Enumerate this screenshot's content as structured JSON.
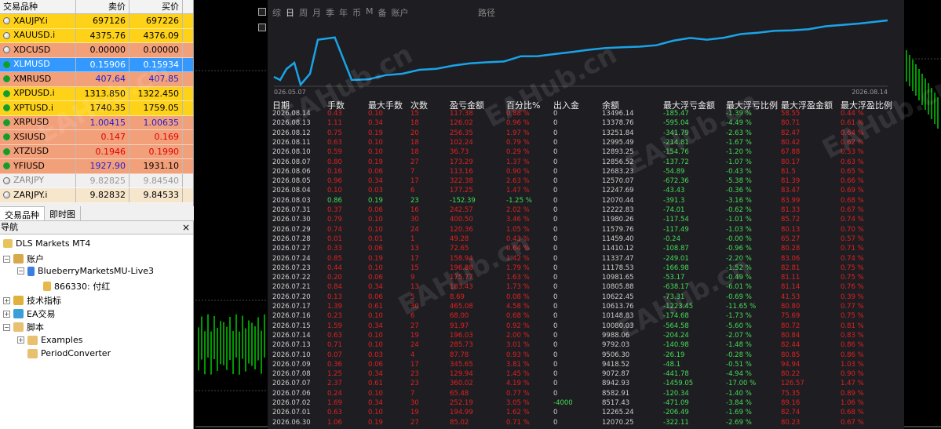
{
  "market_watch": {
    "headers": {
      "symbol": "交易品种",
      "bid": "卖价",
      "ask": "买价"
    },
    "rows": [
      {
        "symbol": "XAUJPY.i",
        "bid": "697126",
        "ask": "697226",
        "style": "yellow",
        "dot": "grey",
        "bid_class": "",
        "ask_class": ""
      },
      {
        "symbol": "XAUUSD.i",
        "bid": "4375.76",
        "ask": "4376.09",
        "style": "yellow",
        "dot": "grey",
        "bid_class": "",
        "ask_class": ""
      },
      {
        "symbol": "XDCUSD",
        "bid": "0.00000",
        "ask": "0.00000",
        "style": "salmon",
        "dot": "grey",
        "bid_class": "",
        "ask_class": ""
      },
      {
        "symbol": "XLMUSD",
        "bid": "0.15906",
        "ask": "0.15934",
        "style": "blue",
        "dot": "green",
        "bid_class": "",
        "ask_class": ""
      },
      {
        "symbol": "XMRUSD",
        "bid": "407.64",
        "ask": "407.85",
        "style": "salmon",
        "dot": "green",
        "bid_class": "v-blue",
        "ask_class": "v-blue"
      },
      {
        "symbol": "XPDUSD.i",
        "bid": "1313.850",
        "ask": "1322.450",
        "style": "yellow",
        "dot": "green",
        "bid_class": "",
        "ask_class": ""
      },
      {
        "symbol": "XPTUSD.i",
        "bid": "1740.35",
        "ask": "1759.05",
        "style": "yellow",
        "dot": "green",
        "bid_class": "",
        "ask_class": ""
      },
      {
        "symbol": "XRPUSD",
        "bid": "1.00415",
        "ask": "1.00635",
        "style": "salmon",
        "dot": "green",
        "bid_class": "v-blue",
        "ask_class": "v-blue"
      },
      {
        "symbol": "XSIUSD",
        "bid": "0.147",
        "ask": "0.169",
        "style": "salmon",
        "dot": "green",
        "bid_class": "v-red",
        "ask_class": "v-red"
      },
      {
        "symbol": "XTZUSD",
        "bid": "0.1946",
        "ask": "0.1990",
        "style": "salmon",
        "dot": "green",
        "bid_class": "v-red",
        "ask_class": "v-red"
      },
      {
        "symbol": "YFIUSD",
        "bid": "1927.90",
        "ask": "1931.10",
        "style": "salmon",
        "dot": "green",
        "bid_class": "v-blue",
        "ask_class": ""
      },
      {
        "symbol": "ZARJPY",
        "bid": "9.82825",
        "ask": "9.84540",
        "style": "grey",
        "dot": "grey",
        "bid_class": "v-grey",
        "ask_class": "v-grey"
      },
      {
        "symbol": "ZARJPY.i",
        "bid": "9.82832",
        "ask": "9.84533",
        "style": "pale",
        "dot": "grey",
        "bid_class": "",
        "ask_class": ""
      }
    ],
    "tabs": [
      "交易品种",
      "即时图"
    ]
  },
  "navigator": {
    "title": "导航",
    "close": "×",
    "items": {
      "root": "DLS Markets MT4",
      "accounts": "账户",
      "server": "BlueberryMarketsMU-Live3",
      "account": "866330: 付红",
      "indicators": "技术指标",
      "ea": "EA交易",
      "scripts": "脚本",
      "examples": "Examples",
      "period_converter": "PeriodConverter"
    }
  },
  "report": {
    "period_tabs": [
      "综",
      "日",
      "周",
      "月",
      "季",
      "年",
      "币",
      "M",
      "备",
      "账户"
    ],
    "active_period": "日",
    "period_label": "路径",
    "equity_start_label": "026.05.07",
    "equity_end_label": "2026.08.14",
    "headers": [
      "日期",
      "手数",
      "最大手数",
      "次数",
      "盈亏金额",
      "百分比%",
      "出入金",
      "余额",
      "最大浮亏金额",
      "最大浮亏比例",
      "最大浮盈金额",
      "最大浮盈比例"
    ],
    "rows": [
      [
        "2026.08.14",
        "0.43",
        "0.10",
        "15",
        "117.38",
        "0.88 %",
        "0",
        "13496.14",
        "-185.47",
        "-1.39 %",
        "58.55",
        "0.44 %"
      ],
      [
        "2026.08.13",
        "1.11",
        "0.34",
        "18",
        "126.02",
        "0.96 %",
        "0",
        "13378.76",
        "-595.04",
        "-4.49 %",
        "80.71",
        "0.61 %"
      ],
      [
        "2026.08.12",
        "0.75",
        "0.19",
        "20",
        "256.35",
        "1.97 %",
        "0",
        "13251.84",
        "-341.79",
        "-2.63 %",
        "82.47",
        "0.64 %"
      ],
      [
        "2026.08.11",
        "0.63",
        "0.10",
        "18",
        "102.24",
        "0.79 %",
        "0",
        "12995.49",
        "-214.81",
        "-1.67 %",
        "80.42",
        "0.62 %"
      ],
      [
        "2026.08.10",
        "0.59",
        "0.10",
        "18",
        "36.73",
        "0.29 %",
        "0",
        "12893.25",
        "-154.76",
        "-1.20 %",
        "67.88",
        "0.53 %"
      ],
      [
        "2026.08.07",
        "0.80",
        "0.19",
        "27",
        "173.29",
        "1.37 %",
        "0",
        "12856.52",
        "-137.72",
        "-1.07 %",
        "80.17",
        "0.63 %"
      ],
      [
        "2026.08.06",
        "0.16",
        "0.06",
        "7",
        "113.16",
        "0.90 %",
        "0",
        "12683.23",
        "-54.89",
        "-0.43 %",
        "81.5",
        "0.65 %"
      ],
      [
        "2026.08.05",
        "0.96",
        "0.34",
        "17",
        "322.38",
        "2.63 %",
        "0",
        "12570.07",
        "-672.36",
        "-5.38 %",
        "81.39",
        "0.66 %"
      ],
      [
        "2026.08.04",
        "0.10",
        "0.03",
        "6",
        "177.25",
        "1.47 %",
        "0",
        "12247.69",
        "-43.43",
        "-0.36 %",
        "83.47",
        "0.69 %"
      ],
      [
        "2026.08.03",
        "0.86",
        "0.19",
        "23",
        "-152.39",
        "-1.25 %",
        "0",
        "12070.44",
        "-391.3",
        "-3.16 %",
        "83.99",
        "0.68 %"
      ],
      [
        "2026.07.31",
        "0.37",
        "0.06",
        "16",
        "242.57",
        "2.02 %",
        "0",
        "12222.83",
        "-74.01",
        "-0.62 %",
        "81.33",
        "0.67 %"
      ],
      [
        "2026.07.30",
        "0.79",
        "0.10",
        "30",
        "400.50",
        "3.46 %",
        "0",
        "11980.26",
        "-117.54",
        "-1.01 %",
        "85.72",
        "0.74 %"
      ],
      [
        "2026.07.29",
        "0.74",
        "0.10",
        "24",
        "120.36",
        "1.05 %",
        "0",
        "11579.76",
        "-117.49",
        "-1.03 %",
        "80.13",
        "0.70 %"
      ],
      [
        "2026.07.28",
        "0.01",
        "0.01",
        "1",
        "49.28",
        "0.43 %",
        "0",
        "11459.40",
        "-0.24",
        "-0.00 %",
        "65.27",
        "0.57 %"
      ],
      [
        "2026.07.27",
        "0.33",
        "0.06",
        "13",
        "72.65",
        "0.64 %",
        "0",
        "11410.12",
        "-108.87",
        "-0.96 %",
        "80.28",
        "0.71 %"
      ],
      [
        "2026.07.24",
        "0.85",
        "0.19",
        "17",
        "158.94",
        "1.42 %",
        "0",
        "11337.47",
        "-249.01",
        "-2.20 %",
        "83.06",
        "0.74 %"
      ],
      [
        "2026.07.23",
        "0.44",
        "0.10",
        "15",
        "196.88",
        "1.79 %",
        "0",
        "11178.53",
        "-166.98",
        "-1.52 %",
        "82.81",
        "0.75 %"
      ],
      [
        "2026.07.22",
        "0.20",
        "0.06",
        "9",
        "175.77",
        "1.63 %",
        "0",
        "10981.65",
        "-53.17",
        "-0.49 %",
        "81.11",
        "0.75 %"
      ],
      [
        "2026.07.21",
        "0.84",
        "0.34",
        "13",
        "183.43",
        "1.73 %",
        "0",
        "10805.88",
        "-638.17",
        "-6.01 %",
        "81.14",
        "0.76 %"
      ],
      [
        "2026.07.20",
        "0.13",
        "0.06",
        "5",
        "8.69",
        "0.08 %",
        "0",
        "10622.45",
        "-73.31",
        "-0.69 %",
        "41.53",
        "0.39 %"
      ],
      [
        "2026.07.17",
        "1.39",
        "0.61",
        "30",
        "465.08",
        "4.58 %",
        "0",
        "10613.76",
        "-1223.45",
        "-11.65 %",
        "80.80",
        "0.77 %"
      ],
      [
        "2026.07.16",
        "0.23",
        "0.10",
        "6",
        "68.00",
        "0.68 %",
        "0",
        "10148.83",
        "-174.68",
        "-1.73 %",
        "75.69",
        "0.75 %"
      ],
      [
        "2026.07.15",
        "1.59",
        "0.34",
        "27",
        "91.97",
        "0.92 %",
        "0",
        "10080.03",
        "-564.58",
        "-5.60 %",
        "80.72",
        "0.81 %"
      ],
      [
        "2026.07.14",
        "0.63",
        "0.10",
        "19",
        "196.03",
        "2.00 %",
        "0",
        "9988.06",
        "-204.24",
        "-2.07 %",
        "80.84",
        "0.83 %"
      ],
      [
        "2026.07.13",
        "0.71",
        "0.10",
        "24",
        "285.73",
        "3.01 %",
        "0",
        "9792.03",
        "-140.98",
        "-1.48 %",
        "82.44",
        "0.86 %"
      ],
      [
        "2026.07.10",
        "0.07",
        "0.03",
        "4",
        "87.78",
        "0.93 %",
        "0",
        "9506.30",
        "-26.19",
        "-0.28 %",
        "80.85",
        "0.86 %"
      ],
      [
        "2026.07.09",
        "0.36",
        "0.06",
        "17",
        "345.65",
        "3.81 %",
        "0",
        "9418.52",
        "-48.1",
        "-0.51 %",
        "94.94",
        "1.03 %"
      ],
      [
        "2026.07.08",
        "1.25",
        "0.34",
        "23",
        "129.94",
        "1.45 %",
        "0",
        "9072.87",
        "-441.78",
        "-4.94 %",
        "80.22",
        "0.90 %"
      ],
      [
        "2026.07.07",
        "2.37",
        "0.61",
        "23",
        "360.02",
        "4.19 %",
        "0",
        "8942.93",
        "-1459.05",
        "-17.00 %",
        "126.57",
        "1.47 %"
      ],
      [
        "2026.07.06",
        "0.24",
        "0.10",
        "7",
        "65.48",
        "0.77 %",
        "0",
        "8582.91",
        "-120.34",
        "-1.40 %",
        "75.35",
        "0.89 %"
      ],
      [
        "2026.07.02",
        "1.69",
        "0.34",
        "30",
        "252.19",
        "3.05 %",
        "-4000",
        "8517.43",
        "-471.09",
        "-3.84 %",
        "89.16",
        "1.06 %"
      ],
      [
        "2026.07.01",
        "0.63",
        "0.10",
        "19",
        "194.99",
        "1.62 %",
        "0",
        "12265.24",
        "-206.49",
        "-1.69 %",
        "82.74",
        "0.68 %"
      ],
      [
        "2026.06.30",
        "1.06",
        "0.19",
        "27",
        "85.02",
        "0.71 %",
        "0",
        "12070.25",
        "-322.11",
        "-2.69 %",
        "80.23",
        "0.67 %"
      ]
    ]
  },
  "watermarks": [
    "EAHub.cn",
    "EAHub.cn",
    "EAHub.cn",
    "EAHub.cn",
    "EAHub.cn",
    "EAHub.cn",
    "EAHub.cn"
  ],
  "colors": {
    "positive": "#44dd55",
    "negative": "#e02020",
    "equity_line": "#1aa3e8",
    "panel_bg": "#1e1e22"
  }
}
